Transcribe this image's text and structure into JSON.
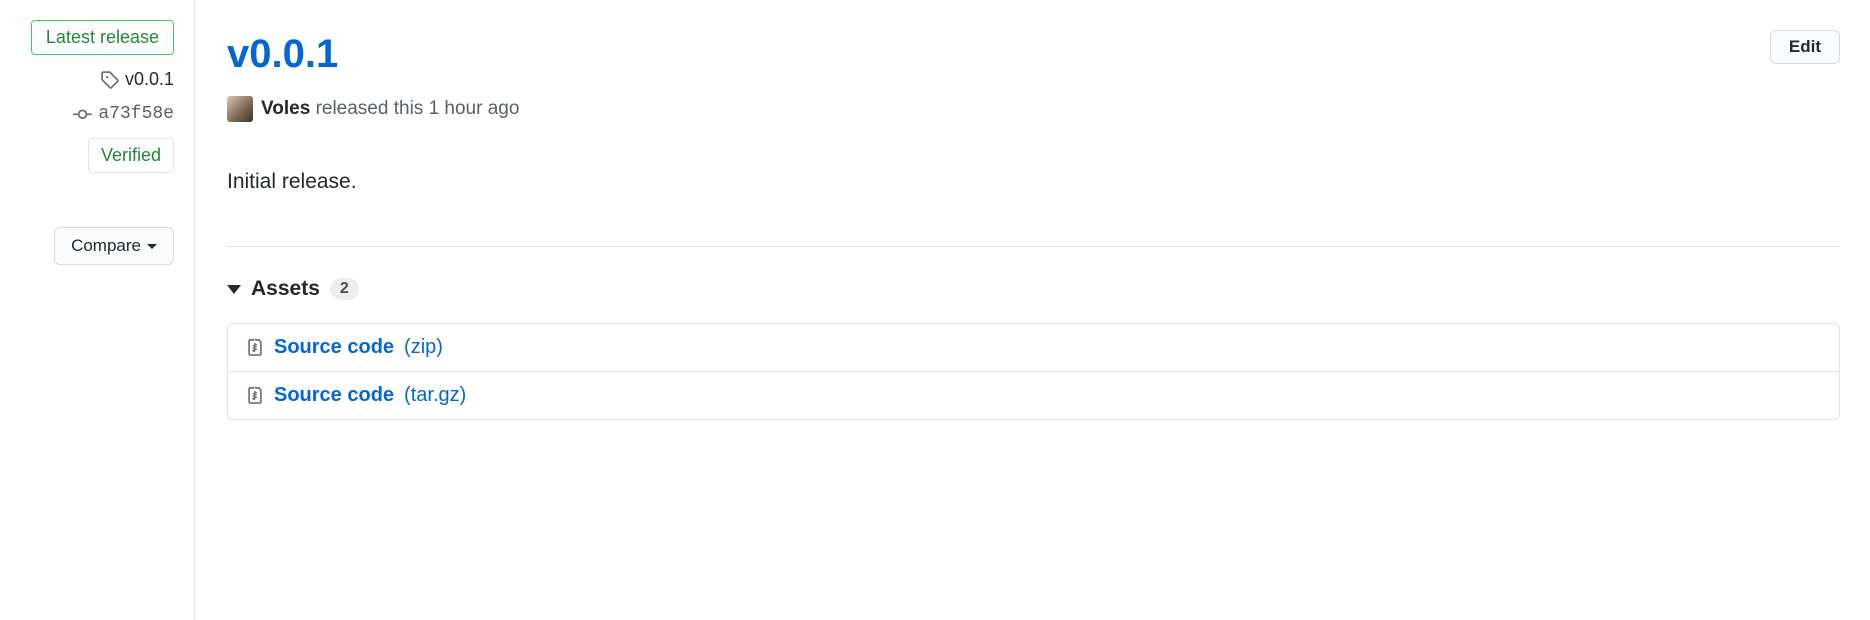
{
  "sidebar": {
    "latest_label": "Latest release",
    "tag": "v0.0.1",
    "commit": "a73f58e",
    "verified_label": "Verified",
    "compare_label": "Compare"
  },
  "release": {
    "title": "v0.0.1",
    "edit_label": "Edit",
    "author": "Voles",
    "byline_suffix": "released this 1 hour ago",
    "body": "Initial release."
  },
  "assets": {
    "title": "Assets",
    "count": "2",
    "items": [
      {
        "name": "Source code",
        "ext": "(zip)"
      },
      {
        "name": "Source code",
        "ext": "(tar.gz)"
      }
    ]
  }
}
